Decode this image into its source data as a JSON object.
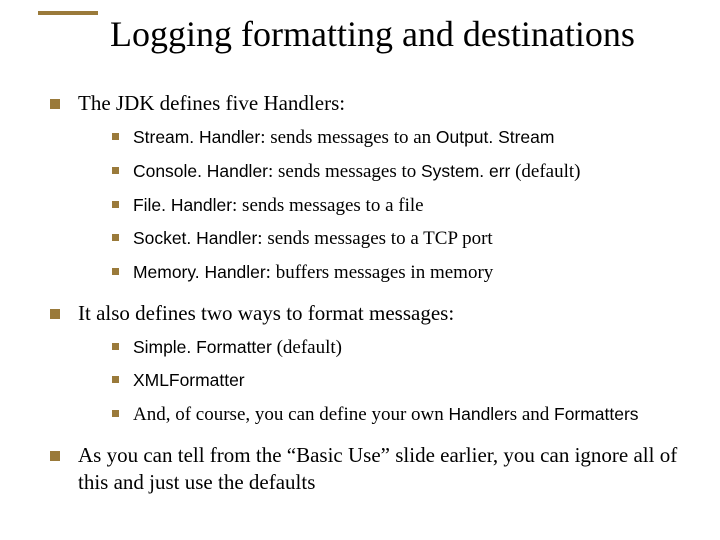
{
  "title": "Logging formatting and destinations",
  "items": [
    {
      "text": "The JDK defines five Handlers:",
      "sub": [
        {
          "code1": "Stream. Handler",
          "mid": ": sends messages to an ",
          "code2": "Output. Stream"
        },
        {
          "code1": "Console. Handler",
          "mid": ": sends messages to ",
          "code2": "System. err",
          "tail": " (default)"
        },
        {
          "code1": "File. Handler",
          "mid": ": sends messages to a file"
        },
        {
          "code1": "Socket. Handler",
          "mid": ": sends messages to a TCP port"
        },
        {
          "code1": "Memory. Handler",
          "mid": ": buffers messages in memory"
        }
      ]
    },
    {
      "text": "It also defines two ways to format messages:",
      "sub": [
        {
          "code1": "Simple. Formatter",
          "tail": " (default)"
        },
        {
          "code1": "XMLFormatter"
        },
        {
          "pre": "And, of course, you can define your own ",
          "code1": "Handler",
          "mid": "s and ",
          "code2": "Formatters"
        }
      ]
    },
    {
      "text": "As you can tell from the “Basic Use” slide earlier, you can ignore all of this and just use the defaults"
    }
  ]
}
